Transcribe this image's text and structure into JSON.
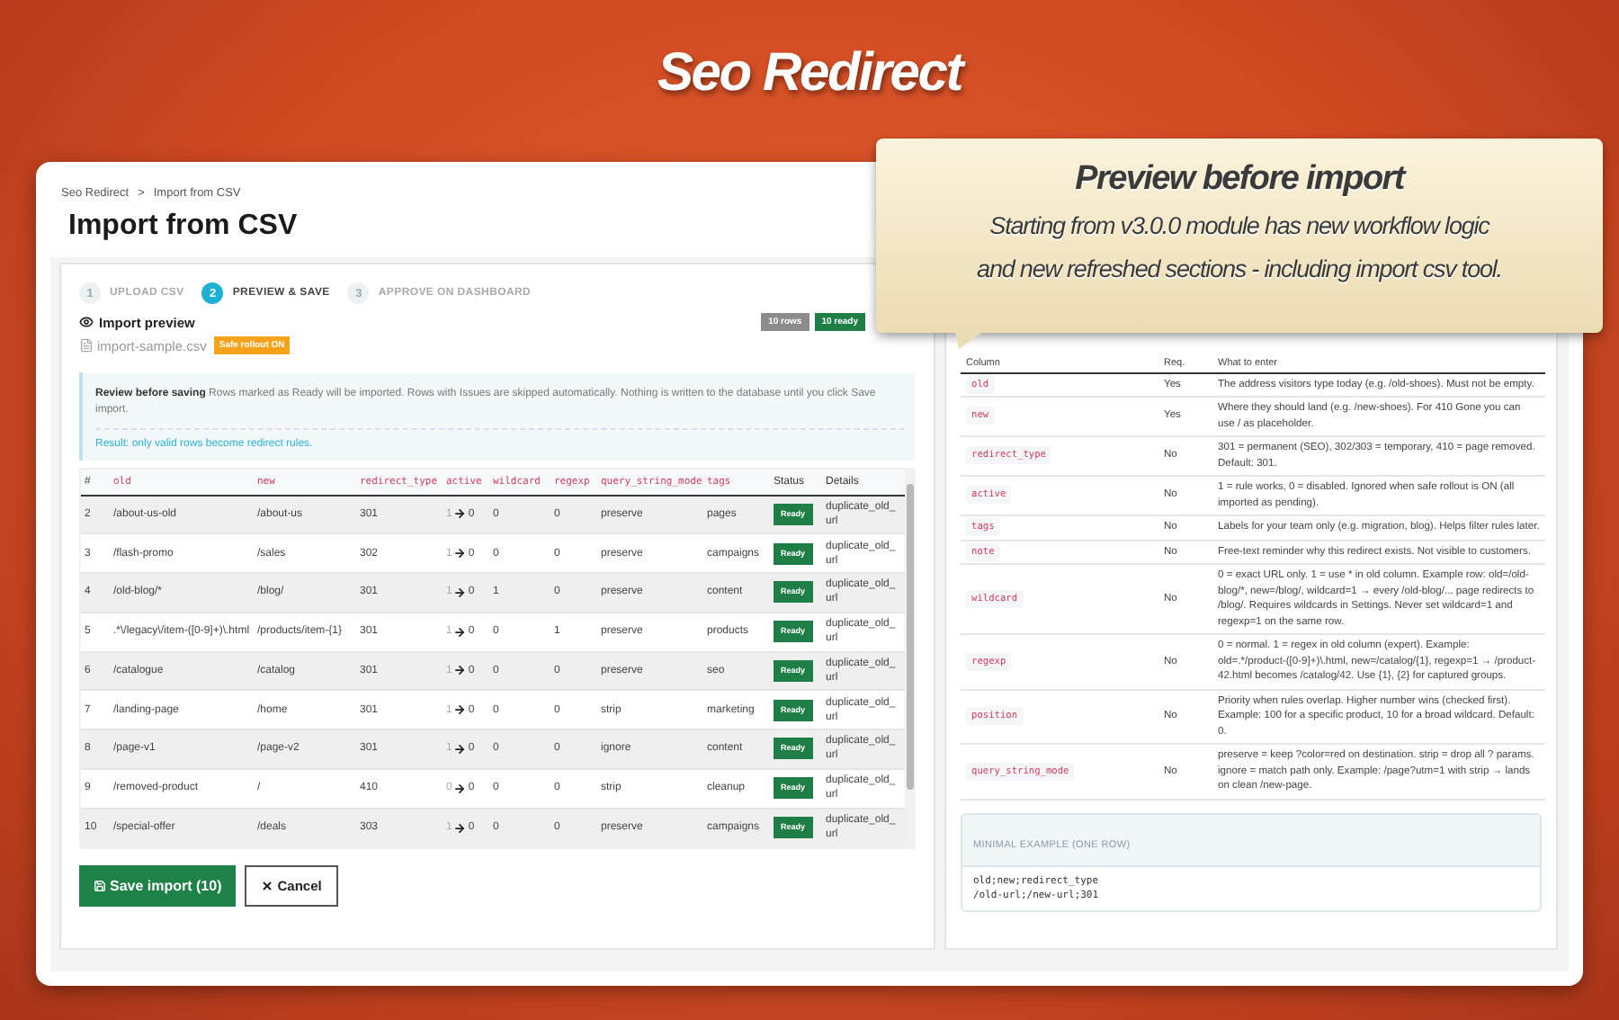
{
  "hero_title": "Seo Redirect",
  "callout": {
    "title": "Preview before import",
    "lines": [
      "Starting from v3.0.0 module has new workflow logic",
      "and new refreshed sections - including import csv tool."
    ]
  },
  "breadcrumb": {
    "items": [
      "Seo Redirect",
      "Import from CSV"
    ],
    "separator": ">"
  },
  "page_title": "Import from CSV",
  "steps": [
    {
      "number": "1",
      "label": "UPLOAD CSV",
      "selected": false
    },
    {
      "number": "2",
      "label": "PREVIEW & SAVE",
      "selected": true
    },
    {
      "number": "3",
      "label": "APPROVE ON DASHBOARD",
      "selected": false
    }
  ],
  "preview": {
    "title": "Import preview",
    "file": "import-sample.csv",
    "rollout_badge": "Safe rollout ON",
    "badges": [
      {
        "text": "10 rows",
        "color": "#8c8c8c"
      },
      {
        "text": "10 ready",
        "color": "#1e7e45"
      }
    ]
  },
  "notice": {
    "text": "**Review before saving** Rows marked as Ready will be imported. Rows with Issues are skipped automatically. Nothing is written to the database until you click Save import.",
    "result": "Result: only valid rows become redirect rules."
  },
  "table": {
    "columns": [
      {
        "label": "#",
        "kind": "plain"
      },
      {
        "label": "old",
        "kind": "field"
      },
      {
        "label": "new",
        "kind": "field"
      },
      {
        "label": "redirect_type",
        "kind": "field"
      },
      {
        "label": "active",
        "kind": "field"
      },
      {
        "label": "wildcard",
        "kind": "field"
      },
      {
        "label": "regexp",
        "kind": "field"
      },
      {
        "label": "query_string_mode",
        "kind": "field"
      },
      {
        "label": "tags",
        "kind": "field"
      },
      {
        "label": "Status",
        "kind": "plain"
      },
      {
        "label": "Details",
        "kind": "plain"
      }
    ],
    "rows": [
      {
        "num": "2",
        "old": "/about-us-old",
        "new": "/about-us",
        "type": "301",
        "active_from": "1",
        "active_to": "0",
        "wildcard": "0",
        "regexp": "0",
        "qsm": "preserve",
        "tags": "pages",
        "status": "Ready",
        "details": "duplicate_old_url"
      },
      {
        "num": "3",
        "old": "/flash-promo",
        "new": "/sales",
        "type": "302",
        "active_from": "1",
        "active_to": "0",
        "wildcard": "0",
        "regexp": "0",
        "qsm": "preserve",
        "tags": "campaigns",
        "status": "Ready",
        "details": "duplicate_old_url"
      },
      {
        "num": "4",
        "old": "/old-blog/*",
        "new": "/blog/",
        "type": "301",
        "active_from": "1",
        "active_to": "0",
        "wildcard": "1",
        "regexp": "0",
        "qsm": "preserve",
        "tags": "content",
        "status": "Ready",
        "details": "duplicate_old_url"
      },
      {
        "num": "5",
        "old": ".*\\/legacy\\/item-([0-9]+)\\.html",
        "new": "/products/item-{1}",
        "type": "301",
        "active_from": "1",
        "active_to": "0",
        "wildcard": "0",
        "regexp": "1",
        "qsm": "preserve",
        "tags": "products",
        "status": "Ready",
        "details": "duplicate_old_url"
      },
      {
        "num": "6",
        "old": "/catalogue",
        "new": "/catalog",
        "type": "301",
        "active_from": "1",
        "active_to": "0",
        "wildcard": "0",
        "regexp": "0",
        "qsm": "preserve",
        "tags": "seo",
        "status": "Ready",
        "details": "duplicate_old_url"
      },
      {
        "num": "7",
        "old": "/landing-page",
        "new": "/home",
        "type": "301",
        "active_from": "1",
        "active_to": "0",
        "wildcard": "0",
        "regexp": "0",
        "qsm": "strip",
        "tags": "marketing",
        "status": "Ready",
        "details": "duplicate_old_url"
      },
      {
        "num": "8",
        "old": "/page-v1",
        "new": "/page-v2",
        "type": "301",
        "active_from": "1",
        "active_to": "0",
        "wildcard": "0",
        "regexp": "0",
        "qsm": "ignore",
        "tags": "content",
        "status": "Ready",
        "details": "duplicate_old_url"
      },
      {
        "num": "9",
        "old": "/removed-product",
        "new": "/",
        "type": "410",
        "active_from": "0",
        "active_to": "0",
        "wildcard": "0",
        "regexp": "0",
        "qsm": "strip",
        "tags": "cleanup",
        "status": "Ready",
        "details": "duplicate_old_url"
      },
      {
        "num": "10",
        "old": "/special-offer",
        "new": "/deals",
        "type": "303",
        "active_from": "1",
        "active_to": "0",
        "wildcard": "0",
        "regexp": "0",
        "qsm": "preserve",
        "tags": "campaigns",
        "status": "Ready",
        "details": "duplicate_old_url"
      }
    ]
  },
  "buttons": {
    "save": "Save import (10)",
    "cancel": "Cancel"
  },
  "help": {
    "columns": [
      "Column",
      "Req.",
      "What to enter"
    ],
    "rows": [
      {
        "column": "old",
        "required": "Yes",
        "description": "The address visitors type today (e.g. /old-shoes). Must not be empty."
      },
      {
        "column": "new",
        "required": "Yes",
        "description": "Where they should land (e.g. /new-shoes). For 410 Gone you can use / as placeholder."
      },
      {
        "column": "redirect_type",
        "required": "No",
        "description": "301 = permanent (SEO), 302/303 = temporary, 410 = page removed. Default: 301."
      },
      {
        "column": "active",
        "required": "No",
        "description": "1 = rule works, 0 = disabled. Ignored when safe rollout is ON (all imported as pending)."
      },
      {
        "column": "tags",
        "required": "No",
        "description": "Labels for your team only (e.g. migration, blog). Helps filter rules later."
      },
      {
        "column": "note",
        "required": "No",
        "description": "Free-text reminder why this redirect exists. Not visible to customers."
      },
      {
        "column": "wildcard",
        "required": "No",
        "description": "0 = exact URL only. 1 = use * in old column. Example row: old=/old-blog/*, new=/blog/, wildcard=1 → every /old-blog/... page redirects to /blog/. Requires wildcards in Settings. Never set wildcard=1 and regexp=1 on the same row."
      },
      {
        "column": "regexp",
        "required": "No",
        "description": "0 = normal. 1 = regex in old column (expert). Example: old=.*/product-([0-9]+)\\.html, new=/catalog/{1}, regexp=1 → /product-42.html becomes /catalog/42. Use {1}, {2} for captured groups."
      },
      {
        "column": "position",
        "required": "No",
        "description": "Priority when rules overlap. Higher number wins (checked first). Example: 100 for a specific product, 10 for a broad wildcard. Default: 0."
      },
      {
        "column": "query_string_mode",
        "required": "No",
        "description": "preserve = keep ?color=red on destination. strip = drop all ? params. ignore = match path only. Example: /page?utm=1 with strip → lands on clean /new-page."
      }
    ],
    "example": {
      "title": "MINIMAL EXAMPLE (ONE ROW)",
      "lines": [
        "old;new;redirect_type",
        "/old-url;/new-url;301"
      ]
    }
  }
}
